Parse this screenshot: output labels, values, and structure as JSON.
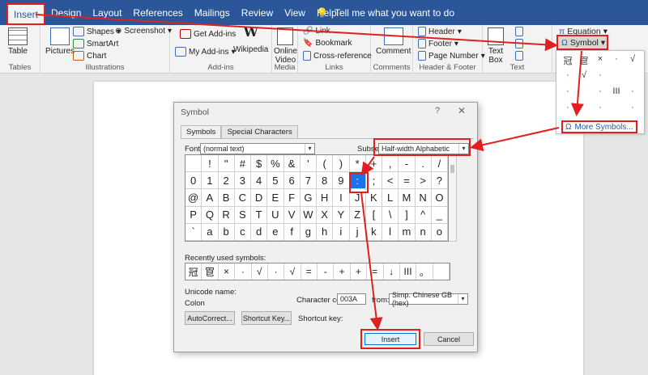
{
  "tabs": [
    "Insert",
    "Design",
    "Layout",
    "References",
    "Mailings",
    "Review",
    "View",
    "Help"
  ],
  "tell_me": "Tell me what you want to do",
  "ribbon": {
    "tables": {
      "table": "Table",
      "label": "Tables"
    },
    "illustrations": {
      "pictures": "Pictures",
      "shapes": "Shapes",
      "smartart": "SmartArt",
      "chart": "Chart",
      "screenshot": "Screenshot",
      "label": "Illustrations"
    },
    "addins": {
      "get": "Get Add-ins",
      "my": "My Add-ins",
      "wikipedia": "Wikipedia",
      "label": "Add-ins"
    },
    "media": {
      "online": "Online",
      "video": "Video",
      "label": "Media"
    },
    "links": {
      "link": "Link",
      "bookmark": "Bookmark",
      "crossref": "Cross-reference",
      "label": "Links"
    },
    "comments": {
      "comment": "Comment",
      "label": "Comments"
    },
    "hf": {
      "header": "Header",
      "footer": "Footer",
      "page_number": "Page Number",
      "label": "Header & Footer"
    },
    "text": {
      "textbox1": "Text",
      "textbox2": "Box",
      "label": "Text"
    },
    "symbols": {
      "equation": "Equation",
      "symbol": "Symbol"
    }
  },
  "symbol_gallery": [
    "冠",
    "冟",
    "×",
    "·",
    "√",
    "·",
    "√",
    "·",
    "III",
    "·",
    "·",
    "·",
    "·",
    "·",
    "·"
  ],
  "more_symbols": "More Symbols...",
  "dialog": {
    "title": "Symbol",
    "help": "?",
    "close": "✕",
    "tab_symbols": "Symbols",
    "tab_special": "Special Characters",
    "font_label": "Font:",
    "font_value": "(normal text)",
    "subset_label": "Subset:",
    "subset_value": "Half-width Alphabetic",
    "grid": [
      [
        "",
        "!",
        "\"",
        "#",
        "$",
        "%",
        "&",
        "'",
        "(",
        ")",
        "*",
        "+",
        ",",
        "-",
        ".",
        "/"
      ],
      [
        "0",
        "1",
        "2",
        "3",
        "4",
        "5",
        "6",
        "7",
        "8",
        "9",
        ":",
        ";",
        "<",
        "=",
        ">",
        "?"
      ],
      [
        "@",
        "A",
        "B",
        "C",
        "D",
        "E",
        "F",
        "G",
        "H",
        "I",
        "J",
        "K",
        "L",
        "M",
        "N",
        "O"
      ],
      [
        "P",
        "Q",
        "R",
        "S",
        "T",
        "U",
        "V",
        "W",
        "X",
        "Y",
        "Z",
        "[",
        "\\",
        "]",
        "^",
        "_"
      ],
      [
        "`",
        "a",
        "b",
        "c",
        "d",
        "e",
        "f",
        "g",
        "h",
        "i",
        "j",
        "k",
        "l",
        "m",
        "n",
        "o"
      ]
    ],
    "recent_label": "Recently used symbols:",
    "recent": [
      "冠",
      "冟",
      "×",
      "·",
      "√",
      "·",
      "√",
      "=",
      "-",
      "+",
      "+",
      "=",
      "↓",
      "III",
      "。",
      ""
    ],
    "unicode_name_label": "Unicode name:",
    "unicode_name": "Colon",
    "char_code_label": "Character code:",
    "char_code": "003A",
    "from_label": "from:",
    "from_value": "Simp. Chinese GB (hex)",
    "autocorrect": "AutoCorrect...",
    "shortcut_key": "Shortcut Key...",
    "shortcut_label": "Shortcut key:",
    "insert": "Insert",
    "cancel": "Cancel"
  },
  "colors": {
    "brand": "#2b579a",
    "annotation": "#e02020",
    "selection": "#1a73e8"
  }
}
